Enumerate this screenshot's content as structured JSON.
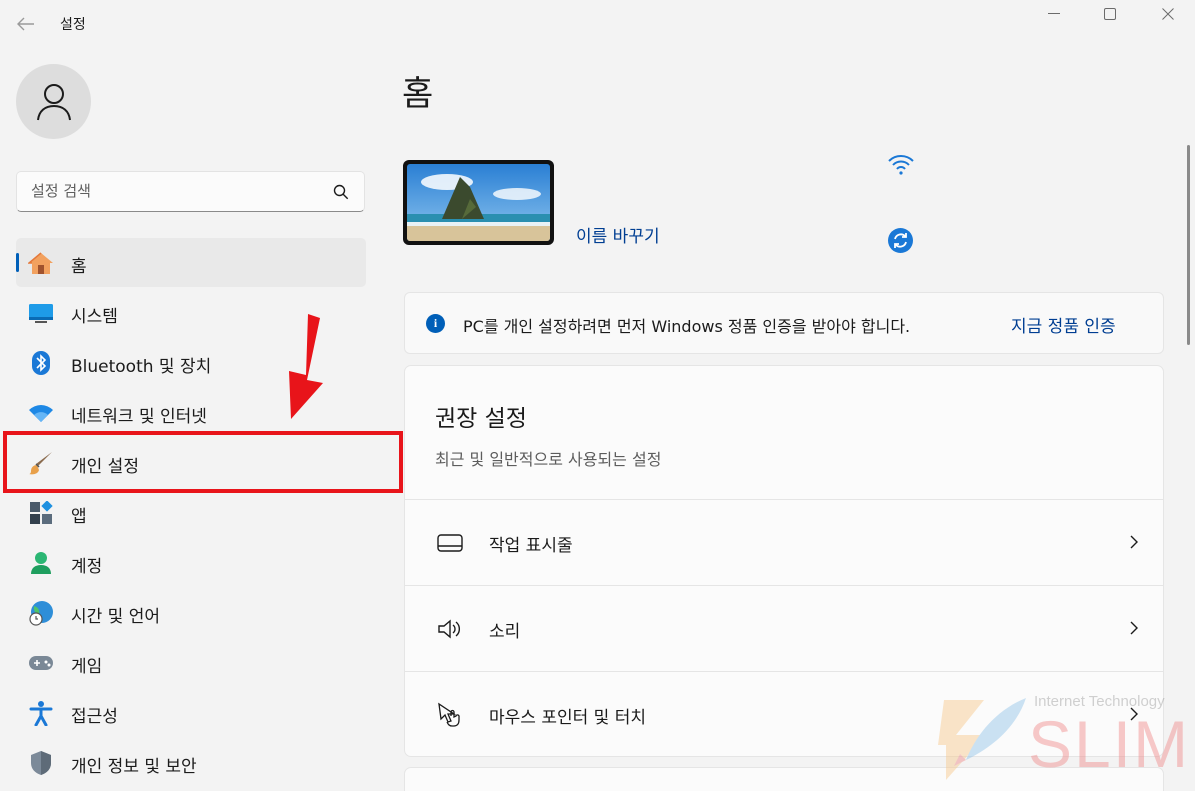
{
  "window": {
    "title": "설정",
    "back_icon": "back-arrow-icon",
    "controls": [
      "minimize",
      "maximize",
      "close"
    ]
  },
  "sidebar": {
    "search_placeholder": "설정 검색",
    "items": [
      {
        "label": "홈",
        "icon": "home-icon",
        "active": true
      },
      {
        "label": "시스템",
        "icon": "system-icon"
      },
      {
        "label": "Bluetooth 및 장치",
        "icon": "bluetooth-icon"
      },
      {
        "label": "네트워크 및 인터넷",
        "icon": "wifi-icon"
      },
      {
        "label": "개인 설정",
        "icon": "brush-icon"
      },
      {
        "label": "앱",
        "icon": "apps-icon"
      },
      {
        "label": "계정",
        "icon": "account-icon"
      },
      {
        "label": "시간 및 언어",
        "icon": "globe-clock-icon"
      },
      {
        "label": "게임",
        "icon": "gamepad-icon"
      },
      {
        "label": "접근성",
        "icon": "accessibility-icon"
      },
      {
        "label": "개인 정보 및 보안",
        "icon": "shield-icon"
      }
    ]
  },
  "main": {
    "page_title": "홈",
    "device": {
      "rename_link": "이름 바꾸기"
    },
    "activation_banner": {
      "text": "PC를 개인 설정하려면 먼저 Windows 정품 인증을 받아야 합니다.",
      "link": "지금 정품 인증"
    },
    "recommended": {
      "title": "권장 설정",
      "subtitle": "최근 및 일반적으로 사용되는 설정",
      "rows": [
        {
          "label": "작업 표시줄",
          "icon": "taskbar-icon"
        },
        {
          "label": "소리",
          "icon": "speaker-icon"
        },
        {
          "label": "마우스 포인터 및 터치",
          "icon": "pointer-touch-icon"
        }
      ]
    }
  },
  "watermark": {
    "small": "Internet Technology",
    "big": "SLIM"
  },
  "colors": {
    "accent": "#005fb8",
    "link": "#003e92",
    "annotation": "#e8141a",
    "background": "#f3f3f3"
  }
}
